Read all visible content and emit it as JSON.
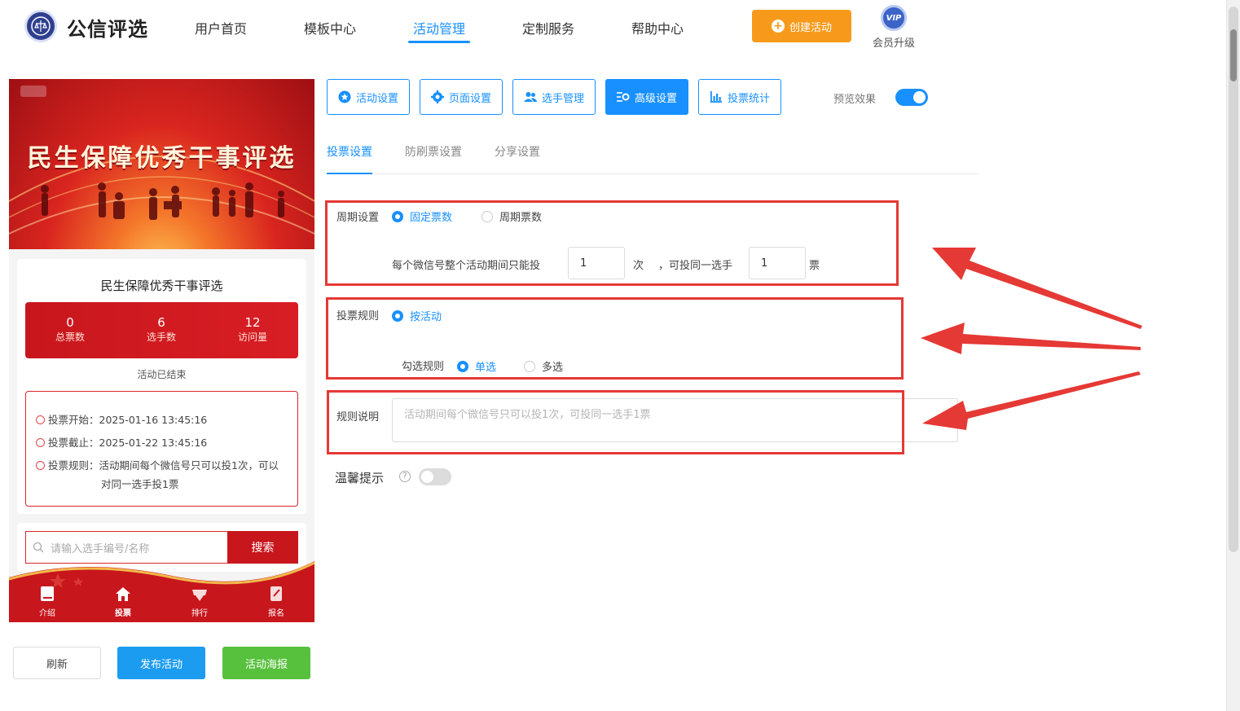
{
  "header": {
    "brand": "公信评选",
    "nav": [
      "用户首页",
      "模板中心",
      "活动管理",
      "定制服务",
      "帮助中心"
    ],
    "create_button": "创建活动",
    "vip_badge": "VIP",
    "vip_label": "会员升级"
  },
  "preview": {
    "banner_title": "民生保障优秀干事评选",
    "card_title": "民生保障优秀干事评选",
    "stats": [
      {
        "value": "0",
        "label": "总票数"
      },
      {
        "value": "6",
        "label": "选手数"
      },
      {
        "value": "12",
        "label": "访问量"
      }
    ],
    "status": "活动已结束",
    "vote_start": "投票开始：2025-01-16 13:45:16",
    "vote_end": "投票截止：2025-01-22 13:45:16",
    "vote_rule_line1": "投票规则：活动期间每个微信号只可以投1次，可以",
    "vote_rule_line2": "对同一选手投1票",
    "search_placeholder": "请输入选手编号/名称",
    "search_button": "搜索",
    "tabs": [
      "介绍",
      "投票",
      "排行",
      "报名"
    ]
  },
  "actions": {
    "refresh": "刷新",
    "publish": "发布活动",
    "poster": "活动海报"
  },
  "toolbar": {
    "buttons": [
      "活动设置",
      "页面设置",
      "选手管理",
      "高级设置",
      "投票统计"
    ],
    "preview_label": "预览效果"
  },
  "subtabs": [
    "投票设置",
    "防刷票设置",
    "分享设置"
  ],
  "period": {
    "label": "周期设置",
    "option_fixed": "固定票数",
    "option_cycle": "周期票数",
    "text_before": "每个微信号整个活动期间只能投",
    "times_value": "1",
    "unit_times": "次",
    "text_middle": "，可投同一选手",
    "votes_value": "1",
    "unit_votes": "票"
  },
  "rule": {
    "label": "投票规则",
    "option_activity": "按活动",
    "check_label": "勾选规则",
    "option_single": "单选",
    "option_multi": "多选"
  },
  "description": {
    "label": "规则说明",
    "placeholder": "活动期间每个微信号只可以投1次，可投同一选手1票"
  },
  "tip": {
    "label": "温馨提示",
    "help": "?"
  },
  "colors": {
    "accent": "#1890ff",
    "orange": "#f79a1b",
    "red": "#c8161d",
    "annotation": "#e53935"
  }
}
